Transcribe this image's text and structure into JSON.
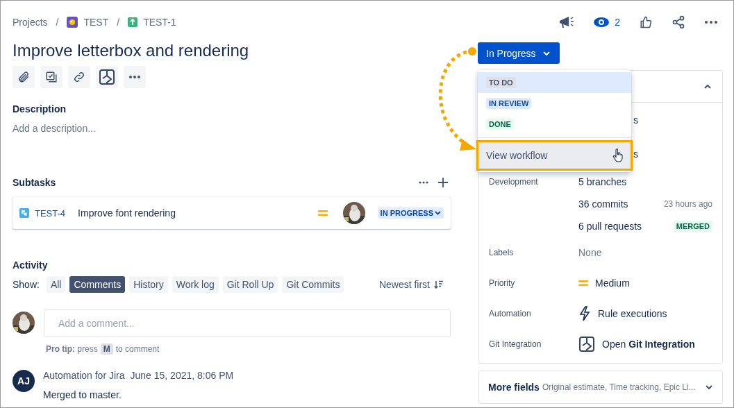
{
  "breadcrumbs": [
    {
      "label": "Projects",
      "kind": "plain"
    },
    {
      "separator": "/",
      "label": "TEST",
      "kind": "project"
    },
    {
      "separator": "/",
      "label": "TEST-1",
      "kind": "story"
    }
  ],
  "header_actions": {
    "watchers": "2"
  },
  "title": "Improve letterbox and rendering",
  "description": {
    "heading": "Description",
    "placeholder": "Add a description..."
  },
  "subtasks": {
    "heading": "Subtasks",
    "items": [
      {
        "key": "TEST-4",
        "summary": "Improve font rendering",
        "status": "IN PROGRESS"
      }
    ]
  },
  "activity": {
    "heading": "Activity",
    "show_label": "Show:",
    "filters": [
      {
        "label": "All",
        "selected": false
      },
      {
        "label": "Comments",
        "selected": true
      },
      {
        "label": "History",
        "selected": false
      },
      {
        "label": "Work log",
        "selected": false
      },
      {
        "label": "Git Roll Up",
        "selected": false
      },
      {
        "label": "Git Commits",
        "selected": false
      }
    ],
    "sort": "Newest first",
    "comment_placeholder": "Add a comment...",
    "pro_tip": "**Pro tip:** press",
    "pro_tip_key": "M",
    "pro_tip_end": "to comment",
    "entries": [
      {
        "initials": "AJ",
        "author": "Automation for Jira",
        "time": "June 15, 2021, 8:06 PM",
        "text": "Merged to master."
      }
    ]
  },
  "status_button": {
    "label": "In Progress"
  },
  "status_menu": {
    "options": [
      {
        "label": "TO DO",
        "kind": "todo",
        "selected": true
      },
      {
        "label": "IN REVIEW",
        "kind": "progress",
        "selected": false
      },
      {
        "label": "DONE",
        "kind": "done",
        "selected": false
      }
    ],
    "link": "View workflow"
  },
  "details": {
    "covered_rows": [
      "s",
      "s"
    ],
    "development": {
      "label": "Development",
      "branches": "5 branches",
      "commits": "36 commits",
      "commits_time": "23 hours ago",
      "pull_requests": "6 pull requests",
      "pr_status": "MERGED"
    },
    "fields": [
      {
        "kind": "empty",
        "label": "Labels",
        "value": "None"
      },
      {
        "kind": "priority",
        "label": "Priority",
        "value": "Medium"
      },
      {
        "kind": "automation",
        "label": "Automation",
        "value": "Rule executions"
      },
      {
        "kind": "git",
        "label": "Git Integration",
        "value": "Open **Git Integration**"
      }
    ]
  },
  "more_fields": {
    "label": "More fields",
    "summary": "Original estimate, Time tracking, Epic Li..."
  }
}
